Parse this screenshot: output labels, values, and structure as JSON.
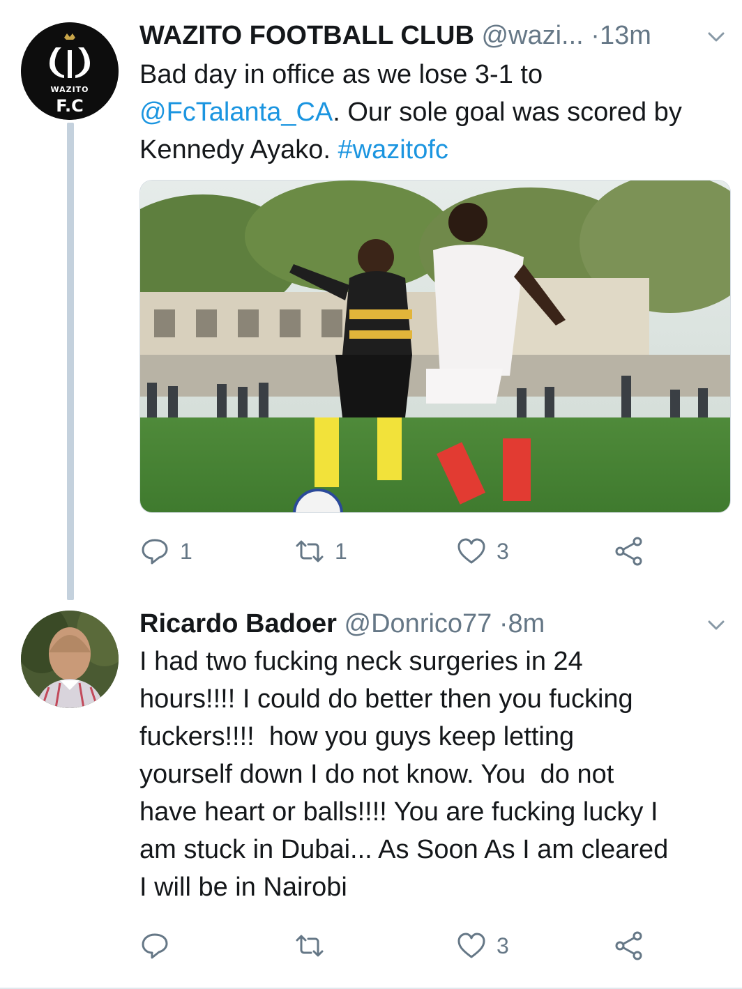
{
  "tweets": [
    {
      "display_name": "WAZITO FOOTBALL CLUB",
      "handle": "@wazi...",
      "separator": "·",
      "time": "13m",
      "avatar_logo_text": "WAZITO",
      "text_before_link": "Bad day in office as we lose 3-1 to\n",
      "mention": "@FcTalanta_CA",
      "text_after_mention": ". Our sole goal was scored by\nKennedy Ayako. ",
      "hashtag": "#wazitofc",
      "reply_count": "1",
      "retweet_count": "1",
      "like_count": "3",
      "media_icon": "soccer-match-photo"
    },
    {
      "display_name": "Ricardo Badoer",
      "handle": "@Donrico77",
      "separator": "·",
      "time": "8m",
      "text": "I had two fucking neck surgeries in 24\nhours!!!! I could do better then you fucking\nfuckers!!!!  how you guys keep letting\nyourself down I do not know. You  do not\nhave heart or balls!!!! You are fucking lucky I\nam stuck in Dubai... As Soon As I am cleared\nI will be in Nairobi",
      "reply_count": "",
      "retweet_count": "",
      "like_count": "3"
    }
  ],
  "colors": {
    "link": "#1b95e0",
    "muted": "#657786",
    "thread_line": "#c4d1dd",
    "text": "#14171a"
  },
  "icons": [
    "reply-icon",
    "retweet-icon",
    "like-icon",
    "share-icon",
    "caret-down-icon"
  ]
}
